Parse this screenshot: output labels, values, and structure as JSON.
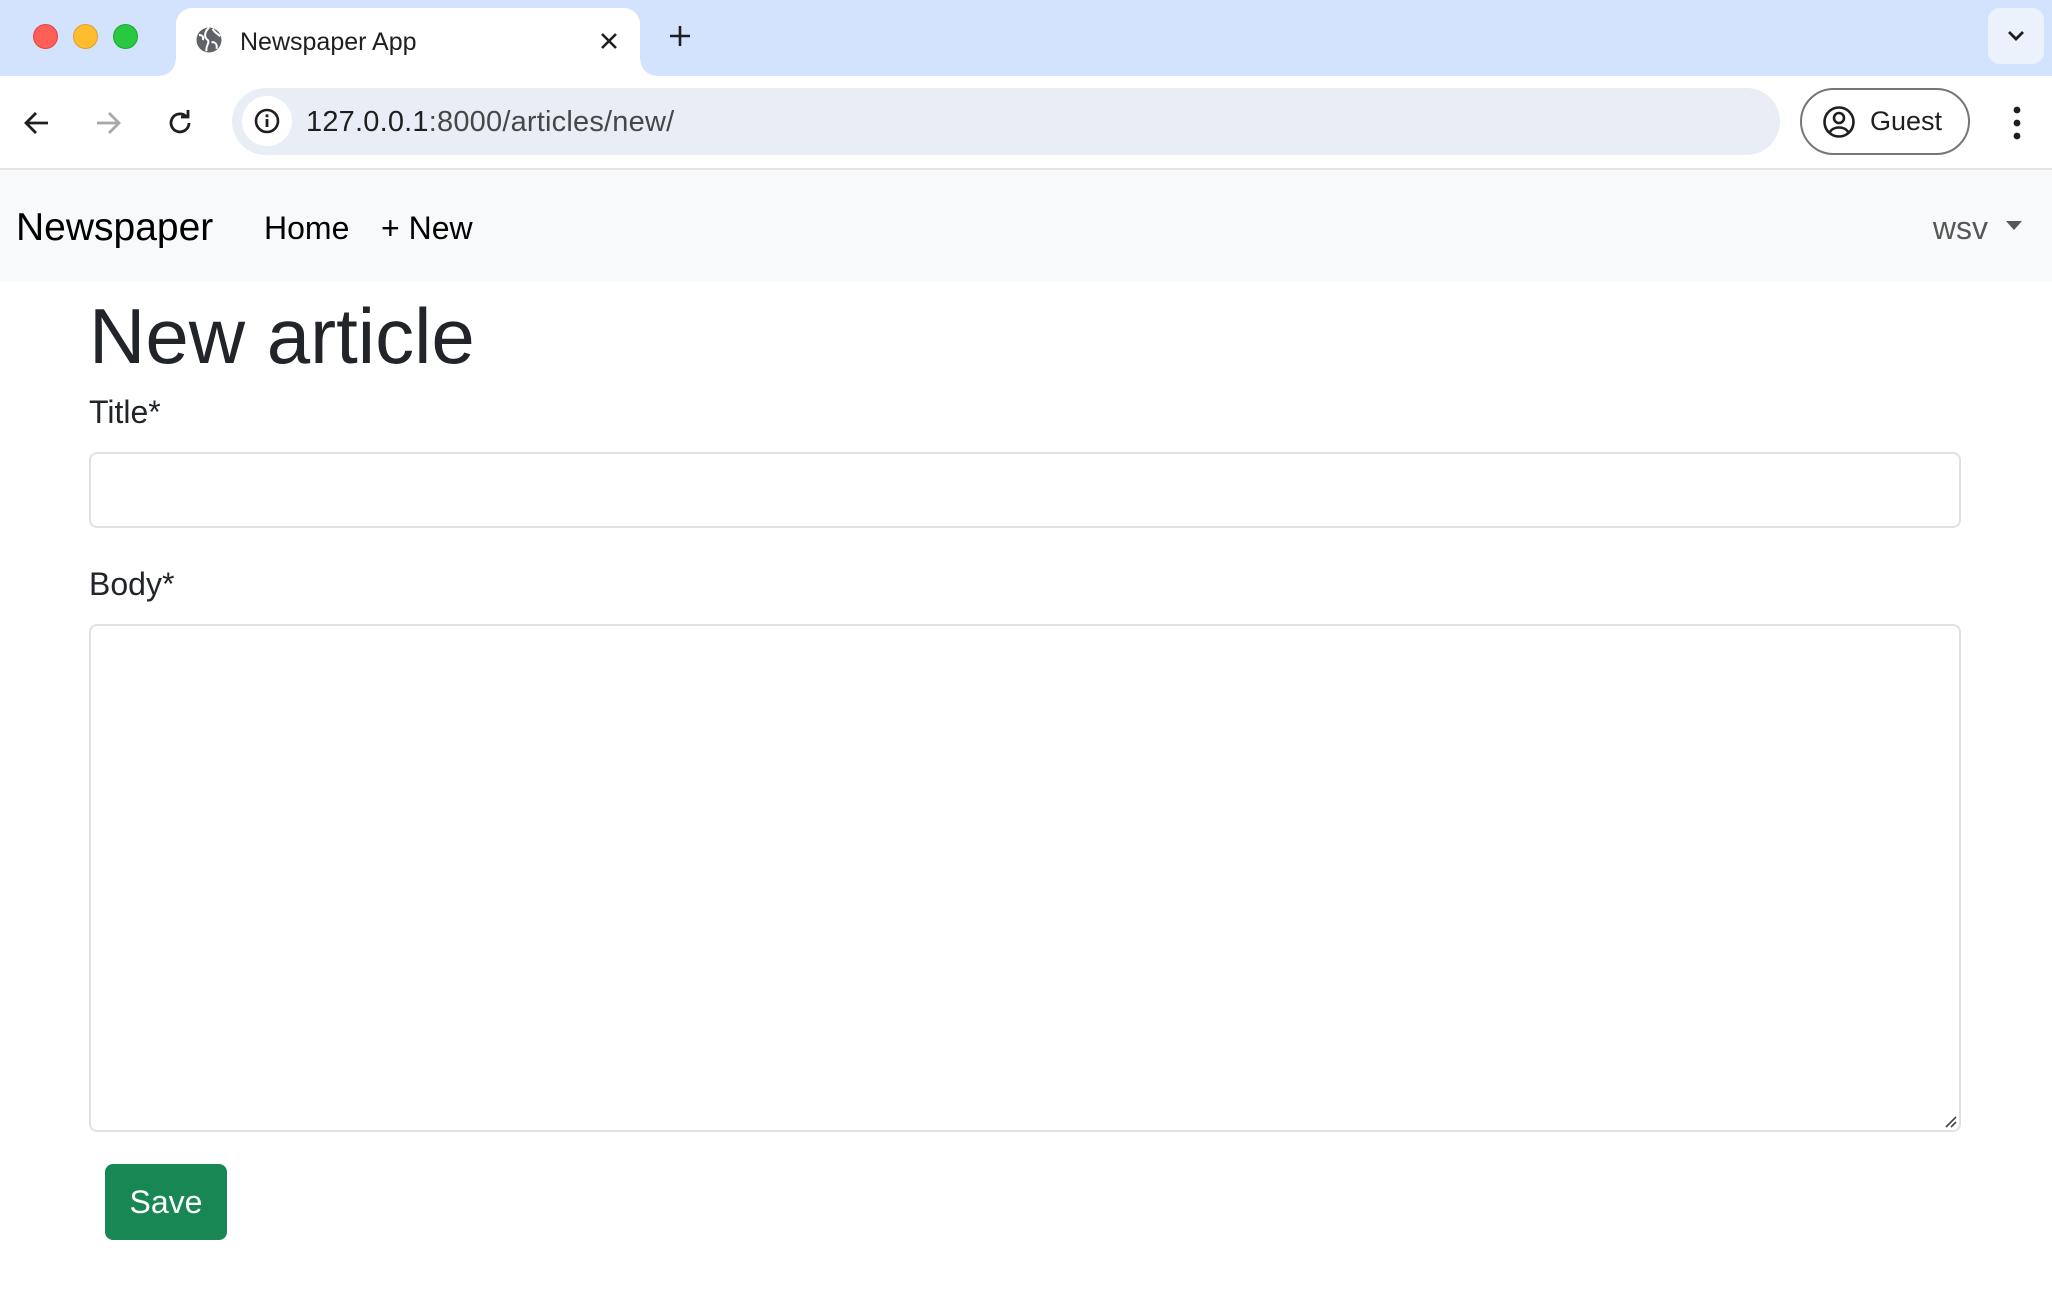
{
  "browser": {
    "tab": {
      "title": "Newspaper App",
      "favicon": "globe-icon"
    },
    "url": {
      "host": "127.0.0.1",
      "rest": ":8000/articles/new/"
    },
    "profile_label": "Guest"
  },
  "navbar": {
    "brand": "Newspaper",
    "links": [
      {
        "label": "Home"
      },
      {
        "label": "+ New"
      }
    ],
    "user": "wsv"
  },
  "form": {
    "heading": "New article",
    "title_label": "Title*",
    "title_value": "",
    "body_label": "Body*",
    "body_value": "",
    "submit_label": "Save"
  },
  "colors": {
    "tabstrip": "#d3e3fd",
    "navbar_bg": "#f8f9fa",
    "save_button": "#198754"
  }
}
